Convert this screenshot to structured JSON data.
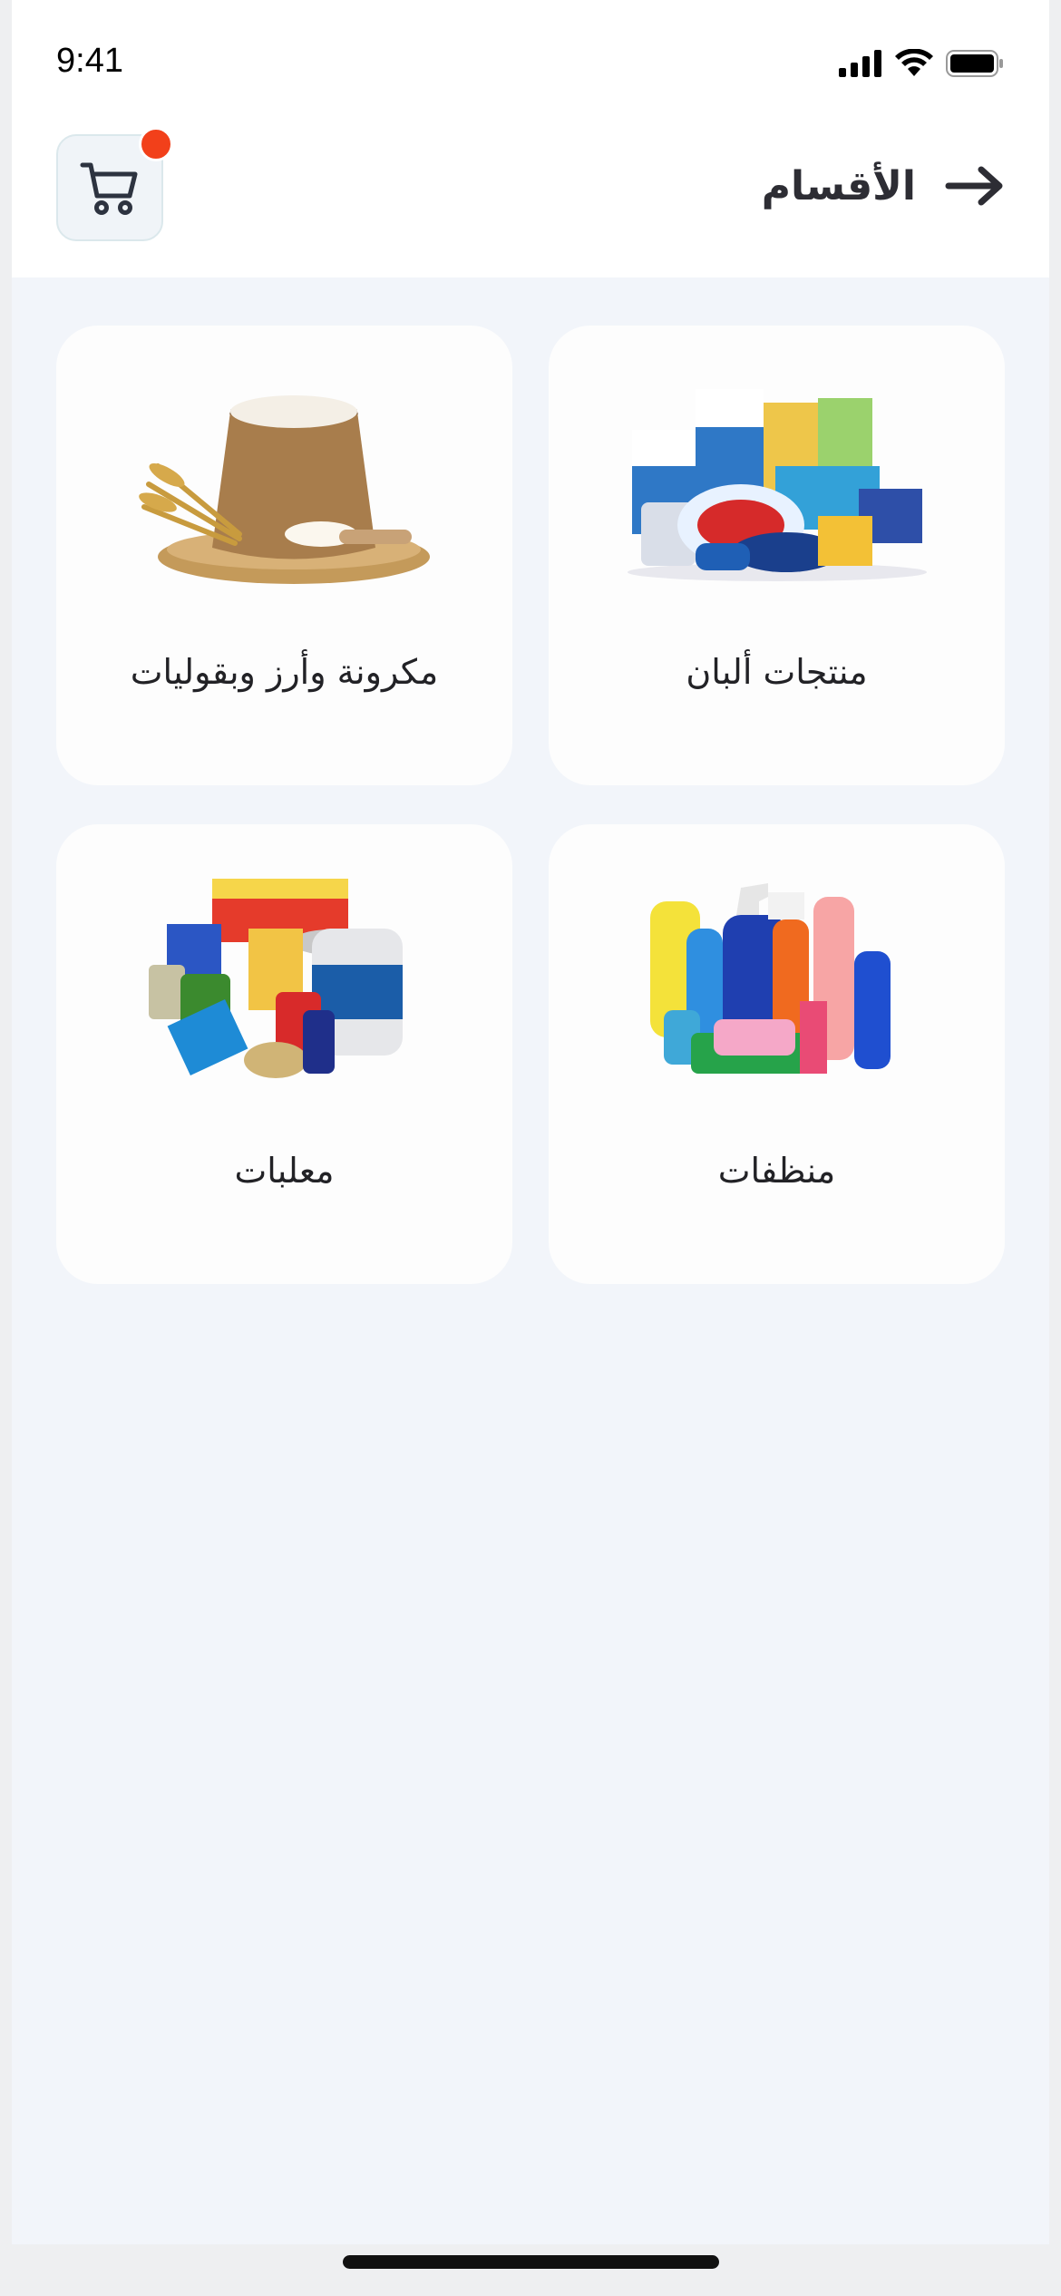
{
  "status_bar": {
    "time": "9:41",
    "icons": [
      "signal-icon",
      "wifi-icon",
      "battery-icon"
    ]
  },
  "header": {
    "title": "الأقسام",
    "back_icon": "arrow-right-icon",
    "cart_icon": "cart-icon",
    "cart_badge_color": "#f2401a"
  },
  "categories": [
    {
      "label": "منتجات ألبان",
      "icon": "dairy-products-image"
    },
    {
      "label": "مكرونة وأرز وبقوليات",
      "icon": "flour-sack-image"
    },
    {
      "label": "منظفات",
      "icon": "cleaning-products-image"
    },
    {
      "label": "معلبات",
      "icon": "canned-goods-image"
    }
  ],
  "colors": {
    "background": "#f2f5fa",
    "card": "#fdfdfd",
    "accent": "#f2401a"
  }
}
